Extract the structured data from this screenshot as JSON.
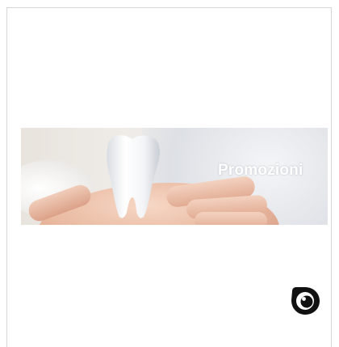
{
  "banner": {
    "text": "Promozioni",
    "image_subject": "tooth-in-hand-image"
  },
  "actions": {
    "view_icon": "eye-icon"
  },
  "colors": {
    "border": "#d6d6d6",
    "banner_text": "#ffffff",
    "icon": "#111111"
  }
}
